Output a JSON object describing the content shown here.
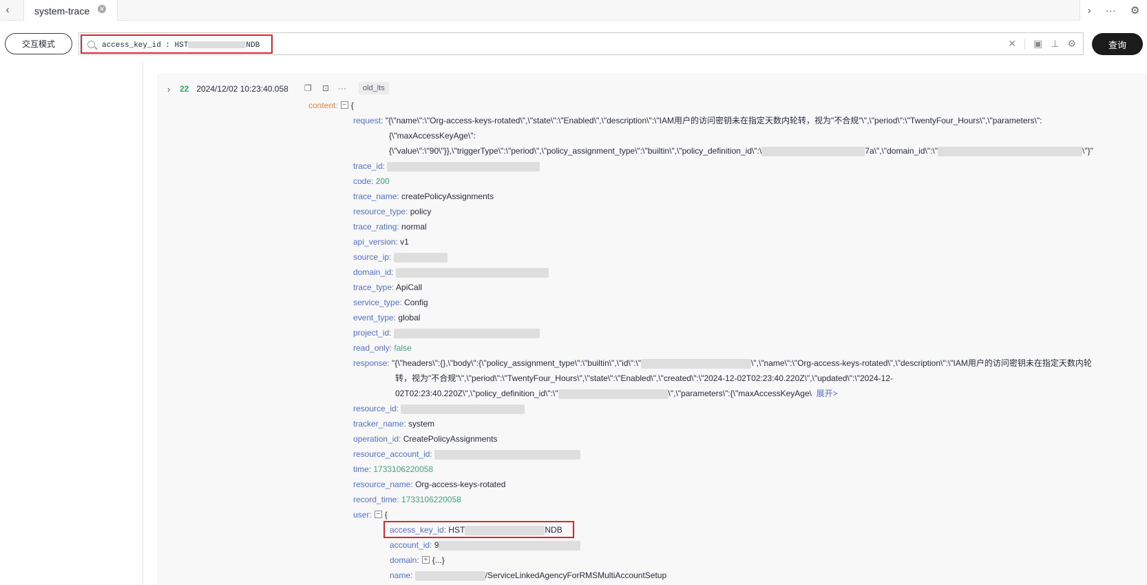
{
  "tabbar": {
    "tab_title": "system-trace",
    "left_arrow": "‹",
    "right_arrow": "›",
    "more": "···",
    "settings_glyph": "⚙"
  },
  "search": {
    "mode_button": "交互模式",
    "value_prefix": "access_key_id : HST",
    "value_suffix": "NDB",
    "query_button": "查询"
  },
  "record": {
    "index": "22",
    "timestamp": "2024/12/02 10:23:40.058",
    "more": "···",
    "tag": "old_lts",
    "content_key": "content:",
    "content_open": "{",
    "request_key": "request:",
    "request_line1": "\"{\\\"name\\\":\\\"Org-access-keys-rotated\\\",\\\"state\\\":\\\"Enabled\\\",\\\"description\\\":\\\"IAM用户的访问密钥未在指定天数内轮转，视为\"不合规\"\\\",\\\"period\\\":\\\"TwentyFour_Hours\\\",\\\"parameters\\\":",
    "request_line2": "{\\\"maxAccessKeyAge\\\":",
    "request_line3a": "{\\\"value\\\":\\\"90\\\"}},\\\"triggerType\\\":\\\"period\\\",\\\"policy_assignment_type\\\":\\\"builtin\\\",\\\"policy_definition_id\\\":\\",
    "request_line3b": "7a\\\",\\\"domain_id\\\":\\\"",
    "request_line3c": "\\\"}\"",
    "trace_id_key": "trace_id:",
    "code_key": "code:",
    "code_val": "200",
    "trace_name_key": "trace_name:",
    "trace_name_val": "createPolicyAssignments",
    "resource_type_key": "resource_type:",
    "resource_type_val": "policy",
    "trace_rating_key": "trace_rating:",
    "trace_rating_val": "normal",
    "api_version_key": "api_version:",
    "api_version_val": "v1",
    "source_ip_key": "source_ip:",
    "domain_id_key": "domain_id:",
    "trace_type_key": "trace_type:",
    "trace_type_val": "ApiCall",
    "service_type_key": "service_type:",
    "service_type_val": "Config",
    "event_type_key": "event_type:",
    "event_type_val": "global",
    "project_id_key": "project_id:",
    "read_only_key": "read_only:",
    "read_only_val": "false",
    "response_key": "response:",
    "response_line1a": "\"{\\\"headers\\\":{},\\\"body\\\":{\\\"policy_assignment_type\\\":\\\"builtin\\\",\\\"id\\\":\\\"",
    "response_line1b": "\\\",\\\"name\\\":\\\"Org-access-keys-rotated\\\",\\\"description\\\":\\\"IAM用户的访问密钥未在指定天数内轮",
    "response_line2": "转，视为\"不合规\"\\\",\\\"period\\\":\\\"TwentyFour_Hours\\\",\\\"state\\\":\\\"Enabled\\\",\\\"created\\\":\\\"2024-12-02T02:23:40.220Z\\\",\\\"updated\\\":\\\"2024-12-",
    "response_line3a": "02T02:23:40.220Z\\\",\\\"policy_definition_id\\\":\\\"",
    "response_line3b": "\\\",\\\"parameters\\\":{\\\"maxAccessKeyAge\\",
    "expand_link": "展开>",
    "resource_id_key": "resource_id:",
    "tracker_name_key": "tracker_name:",
    "tracker_name_val": "system",
    "operation_id_key": "operation_id:",
    "operation_id_val": "CreatePolicyAssignments",
    "resource_account_id_key": "resource_account_id:",
    "time_key": "time:",
    "time_val": "1733106220058",
    "resource_name_key": "resource_name:",
    "resource_name_val": "Org-access-keys-rotated",
    "record_time_key": "record_time:",
    "record_time_val": "1733106220058",
    "user_key": "user:",
    "user_open": "{",
    "access_key_id_key": "access_key_id:",
    "access_key_id_prefix": "HST",
    "access_key_id_suffix": "NDB",
    "account_id_key": "account_id:",
    "account_id_prefix": "9",
    "domain_key": "domain:",
    "domain_val": "{...}",
    "name_key": "name:",
    "name_suffix": "/ServiceLinkedAgencyForRMSMultiAccountSetup"
  }
}
